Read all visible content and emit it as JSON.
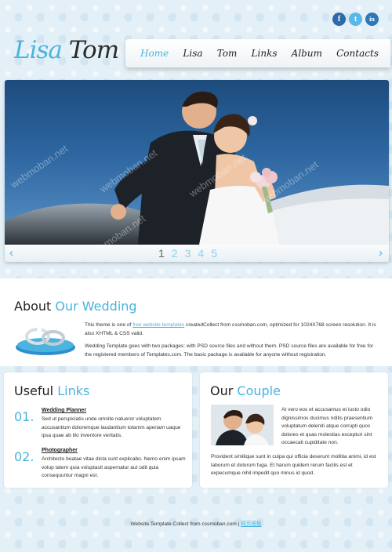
{
  "social": {
    "icons": [
      {
        "name": "facebook-icon",
        "glyph": "f"
      },
      {
        "name": "twitter-icon",
        "glyph": "t"
      },
      {
        "name": "linkedin-icon",
        "glyph": "in"
      }
    ]
  },
  "logo": {
    "part1": "Lisa",
    "part2": "Tom"
  },
  "nav": {
    "items": [
      {
        "label": "Home",
        "active": true
      },
      {
        "label": "Lisa"
      },
      {
        "label": "Tom"
      },
      {
        "label": "Links"
      },
      {
        "label": "Album"
      },
      {
        "label": "Contacts"
      }
    ]
  },
  "slider": {
    "watermark": "webmoban.net",
    "pages": [
      "1",
      "2",
      "3",
      "4",
      "5"
    ],
    "current_page": "1",
    "prev_glyph": "‹",
    "next_glyph": "›"
  },
  "about": {
    "title_plain": "About ",
    "title_highlight": "Our Wedding",
    "p1_before": "This theme is one of ",
    "p1_link": "free website templates",
    "p1_after": " createdCollect from cssmoban.com, optimized for 1024X768 screen resolution. It is also XHTML & CSS valid.",
    "p2": "Wedding Template goes with two packages: with PSD source files and without them. PSD source files are available for free for the registered members of Templates.com. The basic package is available for anyone without registration."
  },
  "links": {
    "title_plain": "Useful ",
    "title_highlight": "Links",
    "items": [
      {
        "num": "01.",
        "title": "Wedding Planner",
        "desc": "Sed ut perspiciatis unde omnite natueror voluptatem accusantium doloremque laudantium totamm aperiam uaque ipsa quae ab illo inventore veritatis."
      },
      {
        "num": "02.",
        "title": "Photographer",
        "desc": "Architecto beatae vitae dicta sunt explicabo. Nemo enim ipsam volup tatem quia voluptasit aspernatur aut odit quia consequuntur magni est."
      }
    ]
  },
  "couple": {
    "title_plain": "Our ",
    "title_highlight": "Couple",
    "text1": "At vero eos et accusamus et iusto odio dignissimos ducimus nditis praesentium voluptatum deleniti atque corrupti quos dolores et quas molestias excepturi sint occaecati cupiditate non.",
    "text2": "Provident similique sunt in culpa qui officia deserunt mollitia animi, id est laborum et dolorum fuga. Et harum quidem rerum facilis est et expecumque nihil impedit quo minus id quod."
  },
  "footer": {
    "text": "Website Template Collect from cssmoban.com | ",
    "link": "网页模板"
  },
  "colors": {
    "accent": "#4ab3df",
    "sky": "#2d66a0",
    "text": "#333333"
  }
}
